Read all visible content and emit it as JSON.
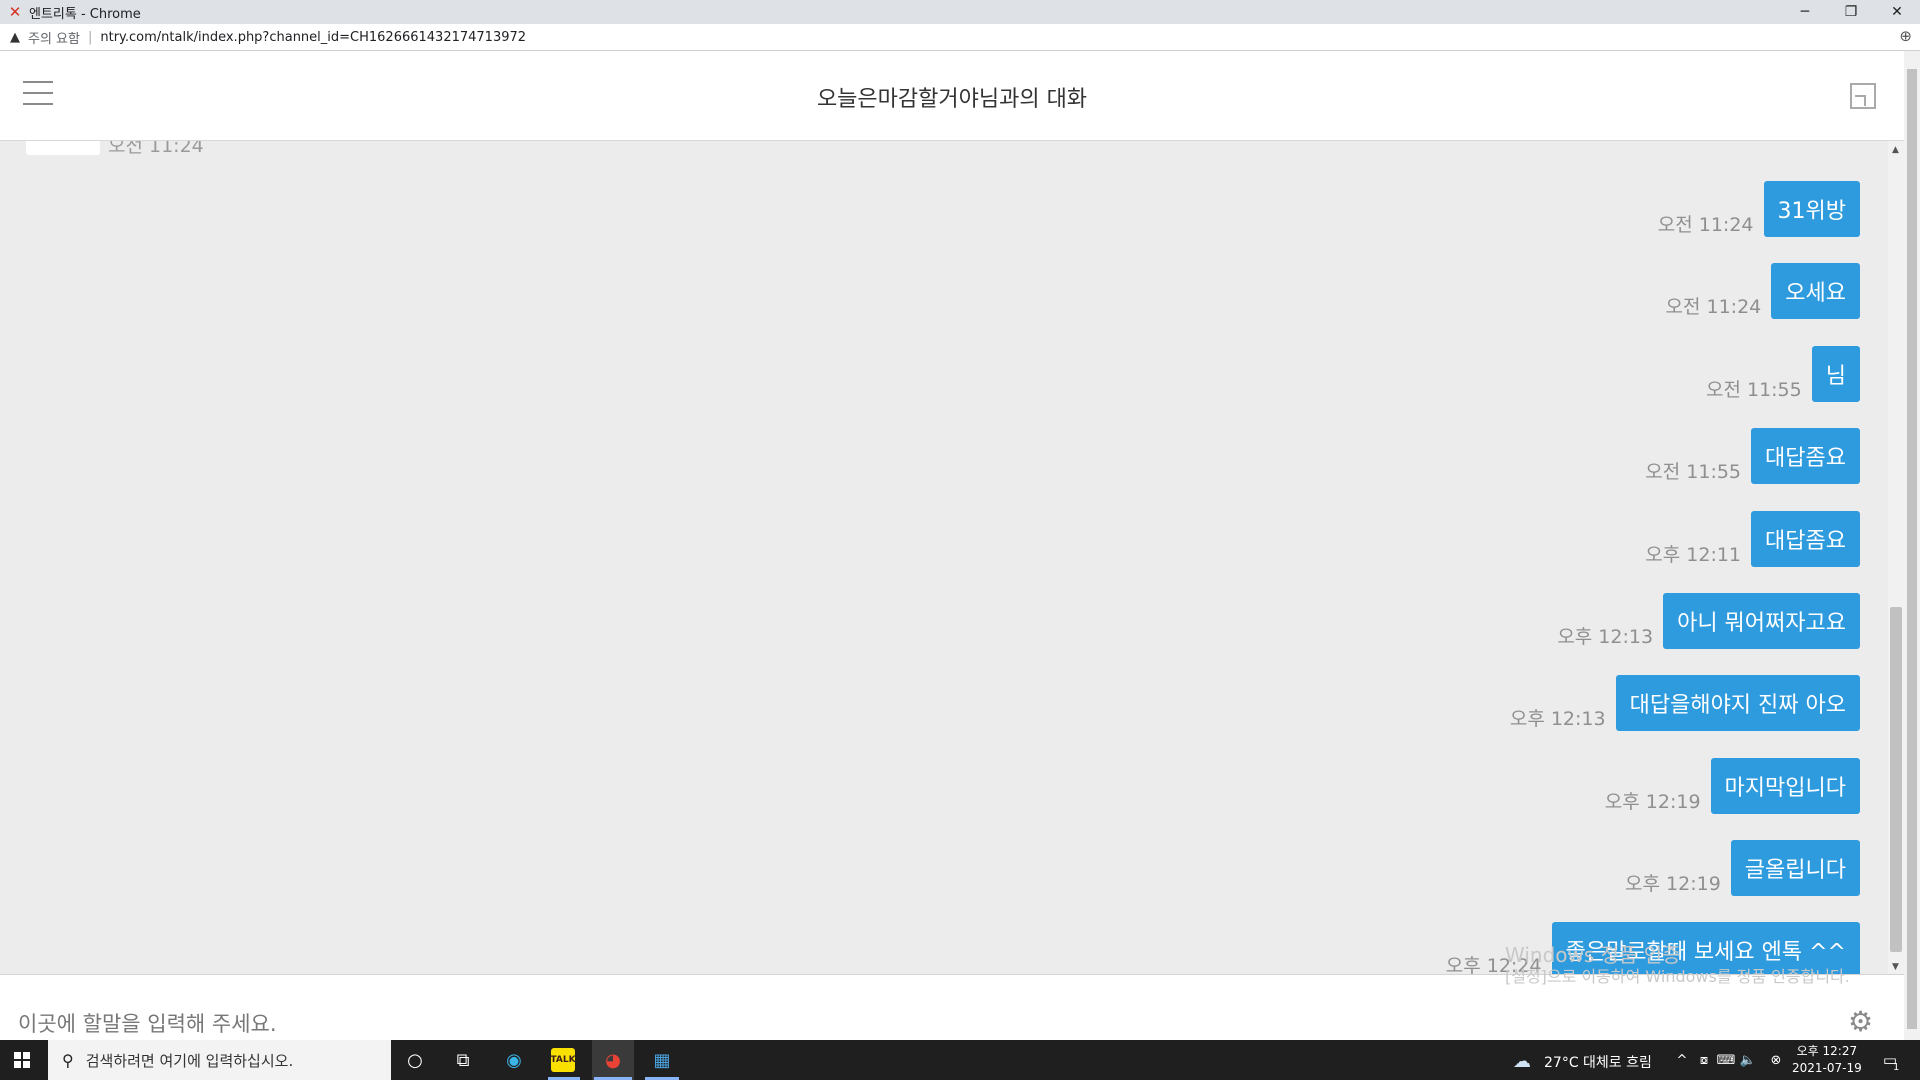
{
  "browser": {
    "window_title": "엔트리톡 - Chrome",
    "security_label": "주의 요함",
    "url": "ntry.com/ntalk/index.php?channel_id=CH1626661432174713972"
  },
  "header": {
    "chat_title": "오늘은마감할거야님과의 대화"
  },
  "partial_message_time": "오전 11:24",
  "messages": [
    {
      "text": "31위방",
      "time": "오전 11:24"
    },
    {
      "text": "오세요",
      "time": "오전 11:24"
    },
    {
      "text": "님",
      "time": "오전 11:55"
    },
    {
      "text": "대답좀요",
      "time": "오전 11:55"
    },
    {
      "text": "대답좀요",
      "time": "오후 12:11"
    },
    {
      "text": "아니 뭐어쩌자고요",
      "time": "오후 12:13"
    },
    {
      "text": "대답을해야지 진짜 아오",
      "time": "오후 12:13"
    },
    {
      "text": "마지막입니다",
      "time": "오후 12:19"
    },
    {
      "text": "글올립니다",
      "time": "오후 12:19"
    },
    {
      "text": "좋은말로할때 보세요 엔톡 ^^",
      "time": "오후 12:24"
    }
  ],
  "input": {
    "placeholder": "이곳에 할말을 입력해 주세요."
  },
  "watermark": {
    "line1": "Windows 정품 인증",
    "line2": "[설정]으로 이동하여 Windows를 정품 인증합니다."
  },
  "taskbar": {
    "search_placeholder": "검색하려면 여기에 입력하십시오.",
    "weather": "27°C  대체로 흐림",
    "time": "오후 12:27",
    "date": "2021-07-19",
    "notification_count": "1"
  }
}
